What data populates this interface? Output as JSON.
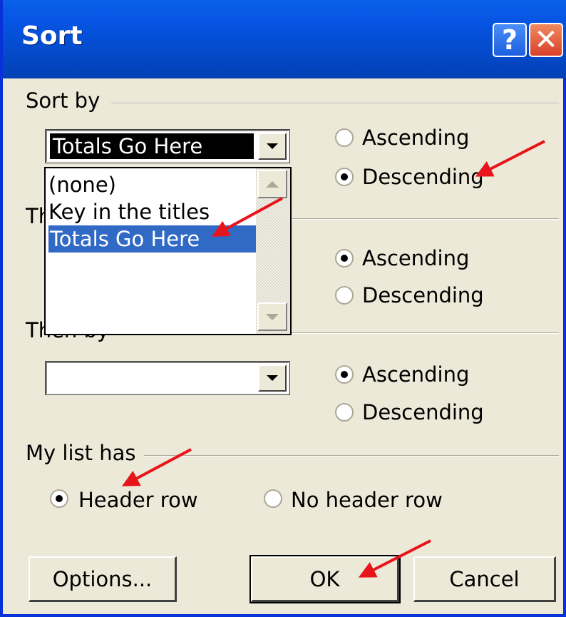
{
  "window": {
    "title": "Sort",
    "help_label": "?",
    "close_label": "✕"
  },
  "sort_by": {
    "label": "Sort by",
    "value": "Totals Go Here",
    "ascending": "Ascending",
    "descending": "Descending",
    "selected": "descending"
  },
  "dropdown_list": {
    "items": [
      "(none)",
      "Key in the titles",
      "Totals Go Here"
    ],
    "selected_index": 2
  },
  "then_by_1": {
    "label_partial": "Th",
    "ascending": "Ascending",
    "descending": "Descending",
    "selected": "ascending"
  },
  "then_by_2": {
    "label": "Then by",
    "value": "",
    "ascending": "Ascending",
    "descending": "Descending",
    "selected": "ascending"
  },
  "list_has": {
    "label": "My list has",
    "header_row": "Header row",
    "no_header_row": "No header row",
    "selected": "header_row"
  },
  "buttons": {
    "options": "Options...",
    "ok": "OK",
    "cancel": "Cancel"
  },
  "annotation_color": "#e8141b"
}
